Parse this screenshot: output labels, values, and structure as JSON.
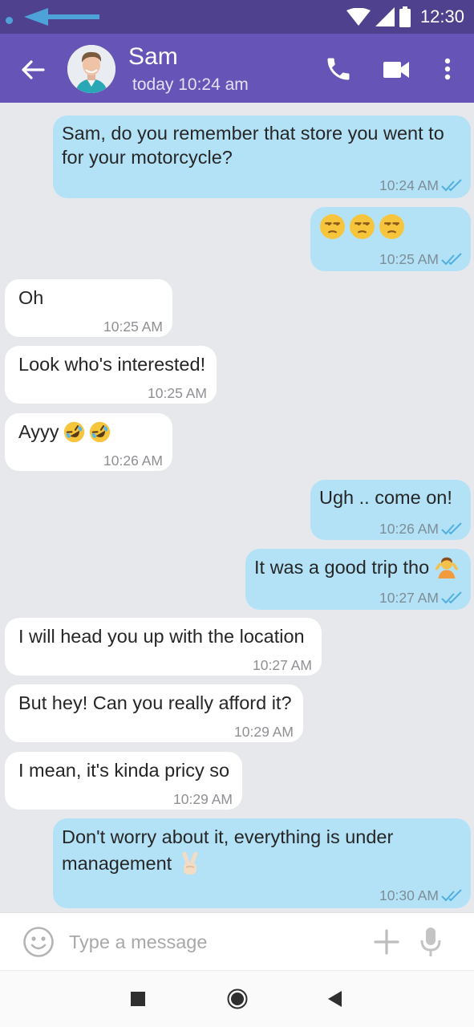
{
  "status_bar": {
    "time": "12:30"
  },
  "header": {
    "contact_name": "Sam",
    "last_seen": "today 10:24 am"
  },
  "messages": [
    {
      "direction": "outgoing",
      "lines": [
        "Sam, do you remember that store you went to",
        "for your motorcycle?"
      ],
      "time": "10:24 AM",
      "status": "read"
    },
    {
      "direction": "outgoing",
      "emojis": [
        "unamused-face",
        "unamused-face",
        "unamused-face"
      ],
      "time": "10:25 AM",
      "status": "read"
    },
    {
      "direction": "incoming",
      "text": "Oh",
      "time": "10:25 AM"
    },
    {
      "direction": "incoming",
      "text": "Look who's interested!",
      "time": "10:25 AM"
    },
    {
      "direction": "incoming",
      "text": "Ayyy",
      "emojis": [
        "rolling-on-floor-laughing",
        "rolling-on-floor-laughing"
      ],
      "time": "10:26 AM"
    },
    {
      "direction": "outgoing",
      "text": "Ugh .. come on!",
      "time": "10:26 AM",
      "status": "read"
    },
    {
      "direction": "outgoing",
      "text": "It was a good trip tho",
      "emojis": [
        "person-shrugging"
      ],
      "time": "10:27 AM",
      "status": "read"
    },
    {
      "direction": "incoming",
      "text": "I will head you up with the location",
      "time": "10:27 AM"
    },
    {
      "direction": "incoming",
      "text": "But hey! Can you really afford it?",
      "time": "10:29 AM"
    },
    {
      "direction": "incoming",
      "text": "I mean, it's kinda pricy so",
      "time": "10:29 AM"
    },
    {
      "direction": "outgoing",
      "lines": [
        "Don't worry about it, everything is under",
        "management"
      ],
      "emojis": [
        "victory-hand"
      ],
      "time": "10:30 AM",
      "status": "read"
    }
  ],
  "composer": {
    "placeholder": "Type a message"
  },
  "icons": {
    "status": [
      "signal-wifi-icon",
      "signal-cellular-icon",
      "battery-icon"
    ],
    "header": [
      "back-arrow-icon",
      "phone-icon",
      "video-camera-icon",
      "more-vertical-icon"
    ],
    "composer": [
      "emoji-icon",
      "plus-icon",
      "microphone-icon"
    ],
    "nav": [
      "recent-apps-icon",
      "home-icon",
      "back-icon"
    ]
  },
  "colors": {
    "status_bar": "#4f418e",
    "app_bar": "#6754b7",
    "chat_background": "#e6e8ec",
    "incoming_bubble": "#ffffff",
    "outgoing_bubble": "#b3e2f7",
    "read_ticks": "#4fb0e0"
  }
}
